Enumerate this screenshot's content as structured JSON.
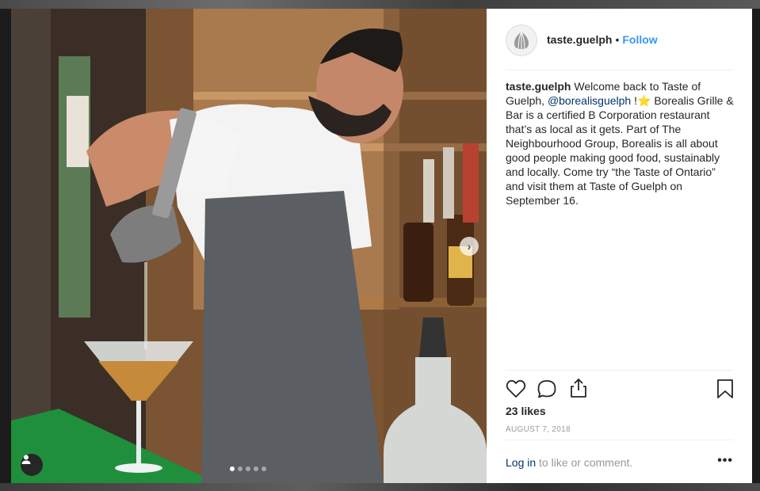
{
  "post": {
    "username": "taste.guelph",
    "separator": "•",
    "follow_label": "Follow",
    "caption": {
      "username": "taste.guelph",
      "part1": " Welcome back to Taste of Guelph, ",
      "mention": "@borealisguelph",
      "part2": " !",
      "star": "⭐",
      "part3": " Borealis Grille & Bar is a certified B Corporation restaurant that’s as local as it gets. Part of The Neighbourhood Group, Borealis is all about good people making good food, sustainably and locally. Come try “the Taste of Ontario” and visit them at Taste of Guelph on September 16."
    },
    "likes": "23 likes",
    "date": "AUGUST 7, 2018",
    "login_link": "Log in",
    "login_rest": " to like or comment.",
    "more_label": "•••",
    "carousel": {
      "count": 5,
      "active_index": 0
    }
  },
  "icons": {
    "like": "heart-icon",
    "comment": "comment-icon",
    "share": "share-icon",
    "save": "bookmark-icon",
    "next": "chevron-right-icon",
    "user_tag": "user-tag-icon",
    "avatar": "logo-icon"
  },
  "colors": {
    "link": "#3897f0",
    "mention": "#003569",
    "text": "#262626",
    "muted": "#999999"
  }
}
